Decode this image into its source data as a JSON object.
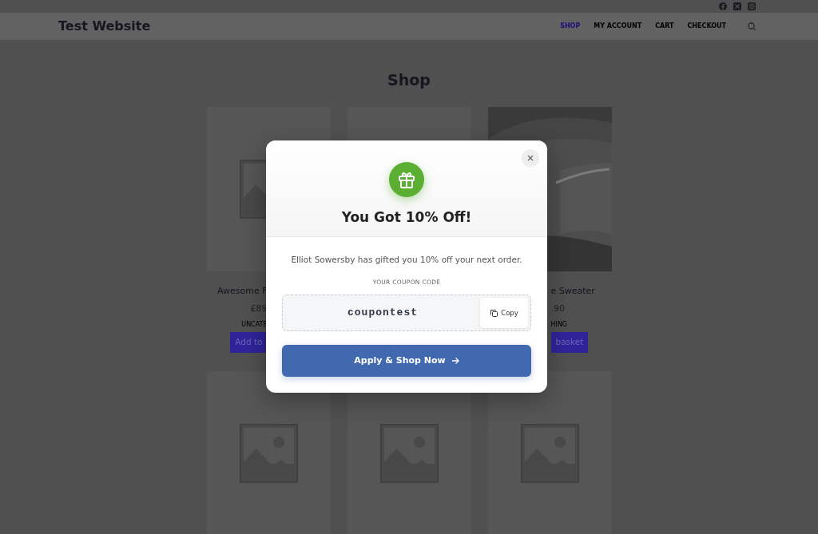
{
  "header": {
    "site_title": "Test Website",
    "nav": [
      {
        "label": "SHOP",
        "selected": true
      },
      {
        "label": "MY ACCOUNT",
        "selected": false
      },
      {
        "label": "CART",
        "selected": false
      },
      {
        "label": "CHECKOUT",
        "selected": false
      }
    ]
  },
  "page_title": "Shop",
  "products": [
    {
      "kind": "placeholder",
      "title": "Awesome F",
      "price": "£89",
      "category": "UNCATE",
      "button": "Add to"
    },
    {
      "kind": "blank"
    },
    {
      "kind": "picture",
      "title": "e Sweater",
      "price": ".90",
      "category": "HING",
      "button": "basket"
    },
    {
      "kind": "placeholder"
    },
    {
      "kind": "placeholder"
    },
    {
      "kind": "placeholder"
    }
  ],
  "modal": {
    "title": "You Got 10% Off!",
    "message": "Elliot Sowersby has gifted you 10% off your next order.",
    "code_label": "YOUR COUPON CODE",
    "code": "coupontest",
    "copy_button": "Copy",
    "apply_button": "Apply & Shop Now"
  }
}
